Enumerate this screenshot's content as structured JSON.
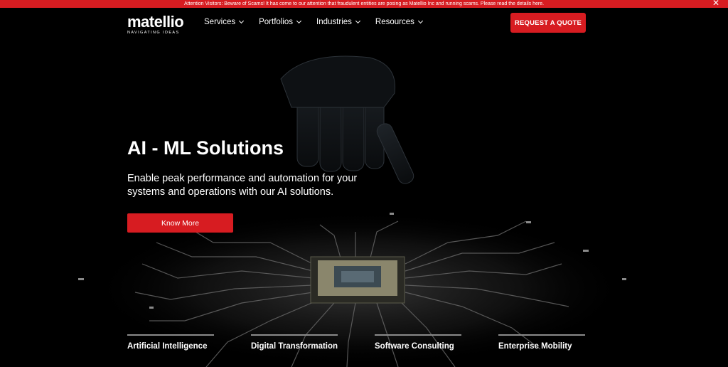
{
  "alert": {
    "text": "Attention Visitors: Beware of Scams! It has come to our attention that fraudulent entities are posing as Matellio Inc and running scams. Please read the details here.",
    "close_icon": "close-icon",
    "close_symbol": "✕"
  },
  "header": {
    "logo": {
      "word": "matellio",
      "tagline": "NAVIGATING IDEAS"
    },
    "nav": [
      {
        "label": "Services"
      },
      {
        "label": "Portfolios"
      },
      {
        "label": "Industries"
      },
      {
        "label": "Resources"
      }
    ],
    "cta_label": "REQUEST A QUOTE"
  },
  "hero": {
    "title": "AI - ML Solutions",
    "subtitle": "Enable peak performance and automation for your systems and operations with our AI solutions.",
    "button_label": "Know More"
  },
  "services": [
    {
      "label": "Artificial Intelligence"
    },
    {
      "label": "Digital Transformation"
    },
    {
      "label": "Software Consulting"
    },
    {
      "label": "Enterprise Mobility"
    }
  ],
  "colors": {
    "accent": "#d71c21",
    "background": "#000000",
    "text": "#ffffff"
  }
}
